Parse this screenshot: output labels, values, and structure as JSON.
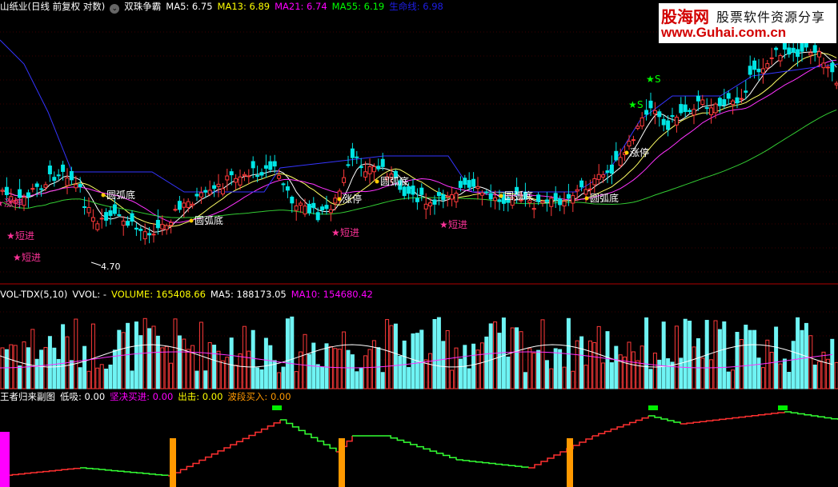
{
  "main_panel": {
    "stock_name": "山纸业(日线 前复权 对数)",
    "indicator_name": "双珠争霸",
    "ma_labels": [
      {
        "text": "MA5: 6.75",
        "color": "#ffffff"
      },
      {
        "text": "MA13: 6.89",
        "color": "#ffff00"
      },
      {
        "text": "MA21: 6.74",
        "color": "#ff00ff"
      },
      {
        "text": "MA55: 6.19",
        "color": "#00ff00"
      },
      {
        "text": "生命线: 6.98",
        "color": "#1e1ee6"
      }
    ],
    "annotations": [
      {
        "text": "圆弧底",
        "color": "#ffffff"
      },
      {
        "text": "圆弧底",
        "color": "#ffffff"
      },
      {
        "text": "涨停",
        "color": "#ffffff"
      },
      {
        "text": "圆弧底",
        "color": "#ffffff"
      },
      {
        "text": "圆弧底",
        "color": "#ffffff"
      },
      {
        "text": "圆弧底",
        "color": "#ffffff"
      },
      {
        "text": "涨停",
        "color": "#ffffff"
      },
      {
        "text": "短进",
        "color": "#ff3399"
      },
      {
        "text": "短进",
        "color": "#ff3399"
      },
      {
        "text": "短进",
        "color": "#ff3399"
      },
      {
        "text": "短进",
        "color": "#ff3399"
      },
      {
        "text": "涨停",
        "color": "#ff3399"
      },
      {
        "text": "S",
        "color": "#00ff00"
      },
      {
        "text": "S",
        "color": "#00ff00"
      }
    ],
    "low_price_label": "4.70"
  },
  "volume_panel": {
    "title": "VOL-TDX(5,10)",
    "items": [
      {
        "text": "VVOL: -",
        "color": "#ffffff"
      },
      {
        "text": "VOLUME: 165408.66",
        "color": "#ffff00"
      },
      {
        "text": "MA5: 188173.05",
        "color": "#ffffff"
      },
      {
        "text": "MA10: 154680.42",
        "color": "#ff00ff"
      }
    ]
  },
  "sub_panel": {
    "title": "王者归来副图",
    "items": [
      {
        "text": "低吸: 0.00",
        "color": "#ffffff"
      },
      {
        "text": "坚决买进: 0.00",
        "color": "#ff00ff"
      },
      {
        "text": "出击: 0.00",
        "color": "#ffff00"
      },
      {
        "text": "波段买入: 0.00",
        "color": "#ff9900"
      }
    ]
  },
  "watermark": {
    "site_cn": "股海网",
    "slogan": "股票软件资源分享",
    "url": "www.Guhai.com.cn"
  }
}
